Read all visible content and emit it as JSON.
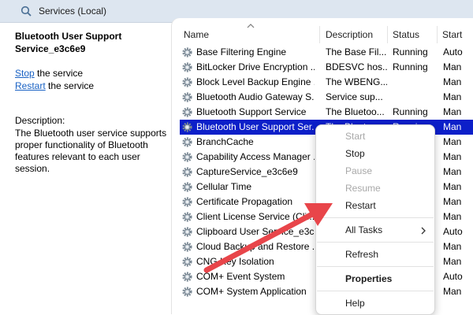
{
  "window": {
    "title": "Services (Local)"
  },
  "details": {
    "service_title": "Bluetooth User Support Service_e3c6e9",
    "stop_link": "Stop",
    "stop_suffix": " the service",
    "restart_link": "Restart",
    "restart_suffix": " the service",
    "description_label": "Description:",
    "description_text": "The Bluetooth user service supports proper functionality of Bluetooth features relevant to each user session."
  },
  "columns": {
    "name": "Name",
    "description": "Description",
    "status": "Status",
    "startup": "Start"
  },
  "services": [
    {
      "name": "Base Filtering Engine",
      "description": "The Base Fil...",
      "status": "Running",
      "startup": "Auto"
    },
    {
      "name": "BitLocker Drive Encryption ...",
      "description": "BDESVC hos...",
      "status": "Running",
      "startup": "Man"
    },
    {
      "name": "Block Level Backup Engine ...",
      "description": "The WBENG...",
      "status": "",
      "startup": "Man"
    },
    {
      "name": "Bluetooth Audio Gateway S...",
      "description": "Service sup...",
      "status": "",
      "startup": "Man"
    },
    {
      "name": "Bluetooth Support Service",
      "description": "The Bluetoo...",
      "status": "Running",
      "startup": "Man"
    },
    {
      "name": "Bluetooth User Support Ser...",
      "description": "The Bluetoo...",
      "status": "Running",
      "startup": "Man"
    },
    {
      "name": "BranchCache",
      "description": "",
      "status": "",
      "startup": "Man"
    },
    {
      "name": "Capability Access Manager ...",
      "description": "",
      "status": "",
      "startup": "Man"
    },
    {
      "name": "CaptureService_e3c6e9",
      "description": "",
      "status": "",
      "startup": "Man"
    },
    {
      "name": "Cellular Time",
      "description": "",
      "status": "",
      "startup": "Man"
    },
    {
      "name": "Certificate Propagation",
      "description": "",
      "status": "",
      "startup": "Man"
    },
    {
      "name": "Client License Service (Cli...",
      "description": "",
      "status": "",
      "startup": "Man"
    },
    {
      "name": "Clipboard User Service_e3c6...",
      "description": "",
      "status": "",
      "startup": "Auto"
    },
    {
      "name": "Cloud Backup and Restore ...",
      "description": "",
      "status": "",
      "startup": "Man"
    },
    {
      "name": "CNG Key Isolation",
      "description": "",
      "status": "",
      "startup": "Man"
    },
    {
      "name": "COM+ Event System",
      "description": "",
      "status": "",
      "startup": "Auto"
    },
    {
      "name": "COM+ System Application",
      "description": "",
      "status": "",
      "startup": "Man"
    }
  ],
  "context_menu": {
    "start": "Start",
    "stop": "Stop",
    "pause": "Pause",
    "resume": "Resume",
    "restart": "Restart",
    "all_tasks": "All Tasks",
    "refresh": "Refresh",
    "properties": "Properties",
    "help": "Help"
  },
  "colors": {
    "selection": "#0c1fc9",
    "link": "#1a62c4",
    "arrow": "#e8454a",
    "titlebar": "#dde6f0"
  }
}
